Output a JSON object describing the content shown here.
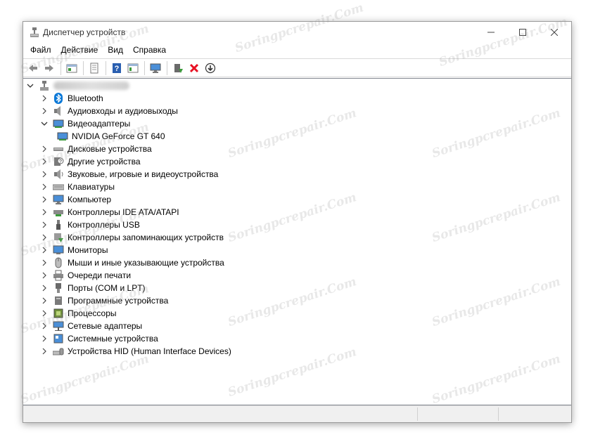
{
  "window": {
    "title": "Диспетчер устройств"
  },
  "menu": [
    "Файл",
    "Действие",
    "Вид",
    "Справка"
  ],
  "toolbar": [
    "back-icon",
    "forward-icon",
    "properties-icon",
    "update-driver-icon",
    "help-icon",
    "view-icon",
    "scan-hardware-icon",
    "enable-device-icon",
    "uninstall-icon",
    "download-icon"
  ],
  "tree": {
    "root_label": "",
    "items": [
      {
        "label": "Bluetooth",
        "icon": "bluetooth-icon",
        "expanded": false
      },
      {
        "label": "Аудиовходы и аудиовыходы",
        "icon": "speaker-icon",
        "expanded": false
      },
      {
        "label": "Видеоадаптеры",
        "icon": "display-adapter-icon",
        "expanded": true
      },
      {
        "label": "NVIDIA GeForce GT 640",
        "icon": "display-adapter-icon",
        "child": true
      },
      {
        "label": "Дисковые устройства",
        "icon": "disk-icon",
        "expanded": false
      },
      {
        "label": "Другие устройства",
        "icon": "unknown-device-icon",
        "expanded": false
      },
      {
        "label": "Звуковые, игровые и видеоустройства",
        "icon": "sound-icon",
        "expanded": false
      },
      {
        "label": "Клавиатуры",
        "icon": "keyboard-icon",
        "expanded": false
      },
      {
        "label": "Компьютер",
        "icon": "computer-icon",
        "expanded": false
      },
      {
        "label": "Контроллеры IDE ATA/ATAPI",
        "icon": "ide-controller-icon",
        "expanded": false
      },
      {
        "label": "Контроллеры USB",
        "icon": "usb-icon",
        "expanded": false
      },
      {
        "label": "Контроллеры запоминающих устройств",
        "icon": "storage-controller-icon",
        "expanded": false
      },
      {
        "label": "Мониторы",
        "icon": "monitor-icon",
        "expanded": false
      },
      {
        "label": "Мыши и иные указывающие устройства",
        "icon": "mouse-icon",
        "expanded": false
      },
      {
        "label": "Очереди печати",
        "icon": "printer-icon",
        "expanded": false
      },
      {
        "label": "Порты (COM и LPT)",
        "icon": "port-icon",
        "expanded": false
      },
      {
        "label": "Программные устройства",
        "icon": "software-device-icon",
        "expanded": false
      },
      {
        "label": "Процессоры",
        "icon": "processor-icon",
        "expanded": false
      },
      {
        "label": "Сетевые адаптеры",
        "icon": "network-icon",
        "expanded": false
      },
      {
        "label": "Системные устройства",
        "icon": "system-device-icon",
        "expanded": false
      },
      {
        "label": "Устройства HID (Human Interface Devices)",
        "icon": "hid-icon",
        "expanded": false
      }
    ]
  },
  "watermark": "Soringpcrepair.Com",
  "colors": {
    "accent": "#0a78d7",
    "red": "#e81123",
    "green": "#3a9a3a"
  }
}
